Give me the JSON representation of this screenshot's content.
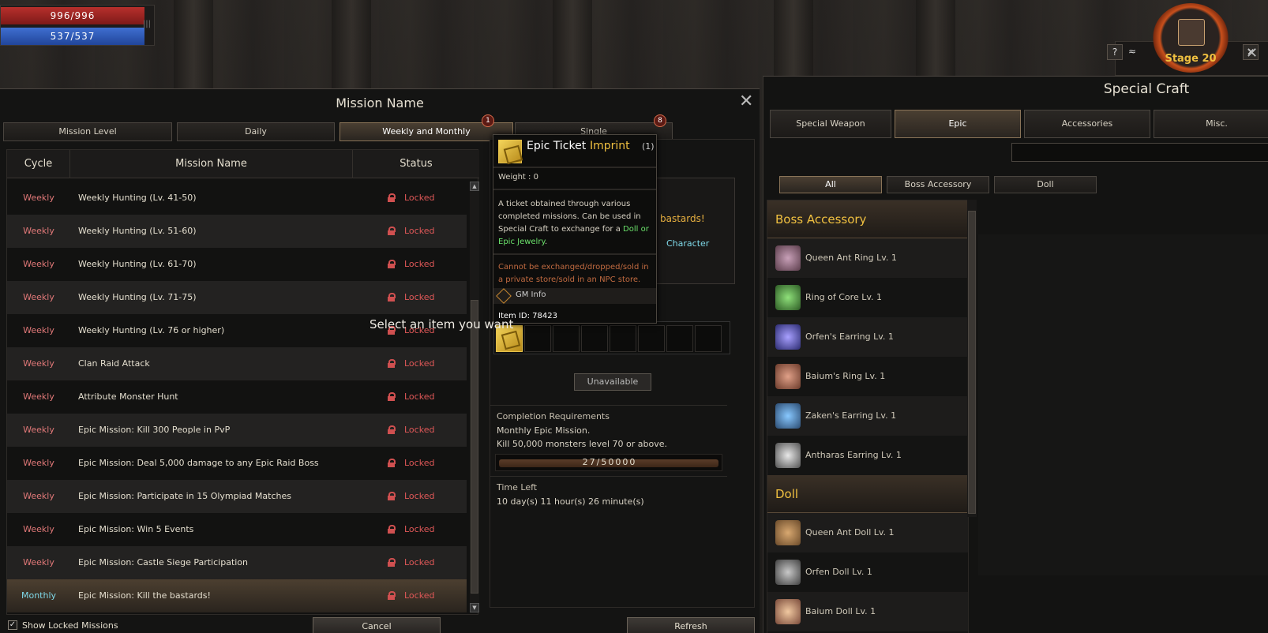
{
  "hud": {
    "hp": "996/996",
    "mp": "537/537"
  },
  "stage": {
    "label": "Stage 20",
    "help": "?",
    "collapse": "≈",
    "close": "✕"
  },
  "mission": {
    "title": "Mission Name",
    "close": "✕",
    "tabs": [
      {
        "label": "Mission Level"
      },
      {
        "label": "Daily"
      },
      {
        "label": "Weekly and Monthly",
        "badge": "1"
      },
      {
        "label": "Single",
        "badge": "8"
      }
    ],
    "columns": {
      "cycle": "Cycle",
      "name": "Mission Name",
      "status": "Status"
    },
    "rows": [
      {
        "cycle": "Weekly",
        "name": "Weekly Hunting (Lv. 41-50)",
        "status": "Locked"
      },
      {
        "cycle": "Weekly",
        "name": "Weekly Hunting (Lv. 51-60)",
        "status": "Locked"
      },
      {
        "cycle": "Weekly",
        "name": "Weekly Hunting (Lv. 61-70)",
        "status": "Locked"
      },
      {
        "cycle": "Weekly",
        "name": "Weekly Hunting (Lv. 71-75)",
        "status": "Locked"
      },
      {
        "cycle": "Weekly",
        "name": "Weekly Hunting (Lv. 76 or higher)",
        "status": "Locked"
      },
      {
        "cycle": "Weekly",
        "name": "Clan Raid Attack",
        "status": "Locked"
      },
      {
        "cycle": "Weekly",
        "name": "Attribute Monster Hunt",
        "status": "Locked"
      },
      {
        "cycle": "Weekly",
        "name": "Epic Mission: Kill 300 People in PvP",
        "status": "Locked"
      },
      {
        "cycle": "Weekly",
        "name": "Epic Mission: Deal 5,000 damage to any Epic Raid Boss",
        "status": "Locked"
      },
      {
        "cycle": "Weekly",
        "name": "Epic Mission: Participate in 15 Olympiad Matches",
        "status": "Locked"
      },
      {
        "cycle": "Weekly",
        "name": "Epic Mission: Win 5 Events",
        "status": "Locked"
      },
      {
        "cycle": "Weekly",
        "name": "Epic Mission: Castle Siege Participation",
        "status": "Locked"
      },
      {
        "cycle": "Monthly",
        "name": "Epic Mission: Kill the bastards!",
        "status": "Locked"
      }
    ],
    "show_locked": "Show Locked Missions",
    "cancel": "Cancel",
    "refresh": "Refresh"
  },
  "detail": {
    "mission_suffix": "bastards!",
    "character": "Character",
    "unavailable": "Unavailable",
    "requirements_title": "Completion Requirements",
    "requirements": [
      "Monthly Epic Mission.",
      "Kill 50,000 monsters level 70 or above."
    ],
    "progress": 0.00054,
    "progress_text": "27/50000",
    "time_left_title": "Time Left",
    "time_left": "10 day(s) 11 hour(s) 26 minute(s)"
  },
  "tooltip": {
    "name": "Epic Ticket",
    "imprint": "Imprint",
    "qty": "(1)",
    "weight": "Weight :  0",
    "desc_pre": "A ticket obtained through various completed missions. Can be used in Special Craft to exchange for a ",
    "desc_green": "Doll or Epic Jewelry",
    "desc_post": ".",
    "warning": "Cannot be exchanged/dropped/sold in a private store/sold in an NPC store.",
    "gm": "GM Info",
    "item_id": "Item ID: 78423"
  },
  "craft": {
    "title": "Special Craft",
    "close": "✕",
    "tabs": [
      "Special Weapon",
      "Epic",
      "Accessories",
      "Misc."
    ],
    "filters": [
      "All",
      "Boss Accessory",
      "Doll"
    ],
    "categories": [
      {
        "name": "Boss Accessory",
        "items": [
          "Queen Ant Ring Lv. 1",
          "Ring of Core Lv. 1",
          "Orfen's Earring Lv. 1",
          "Baium's Ring Lv. 1",
          "Zaken's Earring Lv. 1",
          "Antharas Earring Lv. 1"
        ]
      },
      {
        "name": "Doll",
        "items": [
          "Queen Ant Doll Lv. 1",
          "Orfen Doll Lv. 1",
          "Baium Doll Lv. 1"
        ]
      }
    ],
    "hint": "Select an item you want"
  }
}
